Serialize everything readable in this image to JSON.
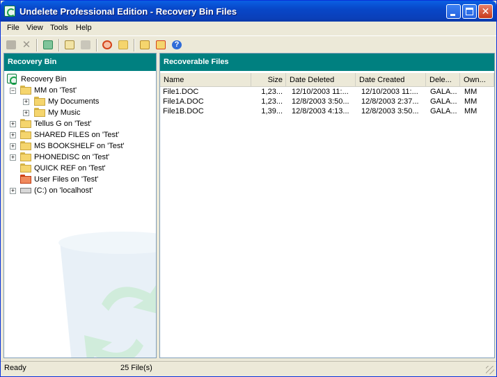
{
  "window": {
    "title": "Undelete Professional Edition - Recovery Bin Files"
  },
  "menu": {
    "file": "File",
    "view": "View",
    "tools": "Tools",
    "help": "Help"
  },
  "left_pane": {
    "header": "Recovery Bin",
    "tree": [
      {
        "label": "Recovery Bin"
      },
      {
        "label": "MM on 'Test'"
      },
      {
        "label": "My Documents"
      },
      {
        "label": "My Music"
      },
      {
        "label": "Tellus G on 'Test'"
      },
      {
        "label": "SHARED FILES on 'Test'"
      },
      {
        "label": "MS BOOKSHELF on 'Test'"
      },
      {
        "label": "PHONEDISC on 'Test'"
      },
      {
        "label": "QUICK REF on 'Test'"
      },
      {
        "label": "User Files on 'Test'"
      },
      {
        "label": "(C:) on 'localhost'"
      }
    ]
  },
  "right_pane": {
    "header": "Recoverable Files",
    "columns": [
      "Name",
      "Size",
      "Date Deleted",
      "Date Created",
      "Dele...",
      "Own..."
    ],
    "rows": [
      [
        "File1.DOC",
        "1,23...",
        "12/10/2003 11:...",
        "12/10/2003 11:...",
        "GALA...",
        "MM"
      ],
      [
        "File1A.DOC",
        "1,23...",
        "12/8/2003 3:50...",
        "12/8/2003 2:37...",
        "GALA...",
        "MM"
      ],
      [
        "File1B.DOC",
        "1,39...",
        "12/8/2003 4:13...",
        "12/8/2003 3:50...",
        "GALA...",
        "MM"
      ]
    ]
  },
  "status": {
    "left": "Ready",
    "count": "25 File(s)"
  },
  "colors": {
    "pane_header": "#008080",
    "titlebar": "#0A5FE3"
  }
}
